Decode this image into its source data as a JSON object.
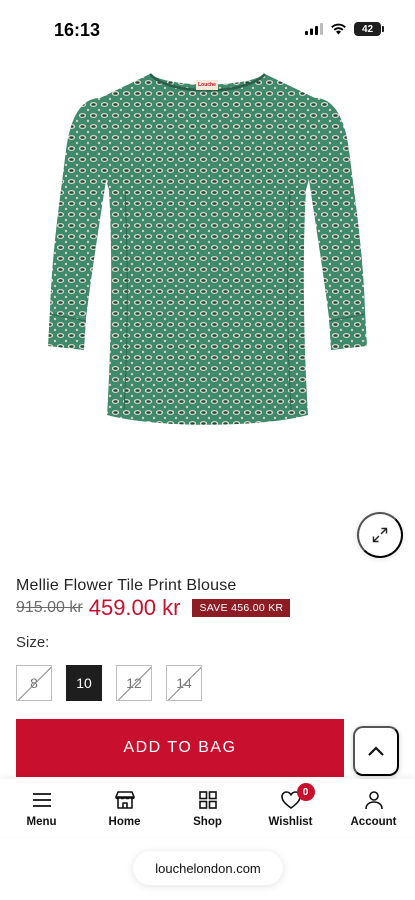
{
  "status_bar": {
    "time": "16:13",
    "battery": "42"
  },
  "product": {
    "brand_tag": "Louche",
    "title": "Mellie Flower Tile Print Blouse",
    "price_old": "915.00 kr",
    "price_new": "459.00 kr",
    "save_badge": "SAVE 456.00 KR"
  },
  "sizes": {
    "label": "Size:",
    "options": [
      {
        "label": "8",
        "state": "unavailable"
      },
      {
        "label": "10",
        "state": "selected"
      },
      {
        "label": "12",
        "state": "unavailable"
      },
      {
        "label": "14",
        "state": "unavailable"
      }
    ]
  },
  "actions": {
    "add_to_bag": "ADD TO BAG"
  },
  "bottom_nav": {
    "items": [
      {
        "label": "Menu",
        "icon": "menu-icon"
      },
      {
        "label": "Home",
        "icon": "store-icon"
      },
      {
        "label": "Shop",
        "icon": "grid-icon"
      },
      {
        "label": "Wishlist",
        "icon": "heart-icon",
        "badge": "0"
      },
      {
        "label": "Account",
        "icon": "user-icon"
      }
    ]
  },
  "browser": {
    "url": "louchelondon.com"
  },
  "colors": {
    "accent": "#c8102e",
    "badge_dark": "#8d1d24",
    "blouse_green": "#3f8a6c"
  }
}
